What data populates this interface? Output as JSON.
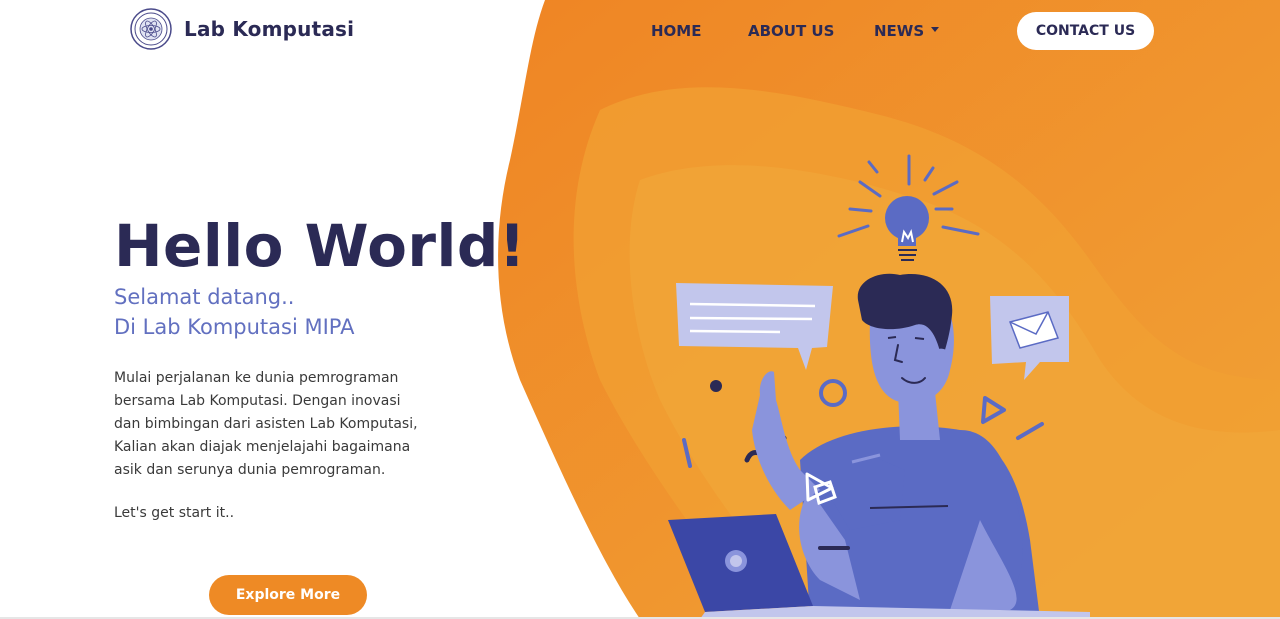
{
  "brand": {
    "name": "Lab Komputasi",
    "logo_icon": "university-seal-icon"
  },
  "nav": {
    "items": [
      {
        "label": "HOME"
      },
      {
        "label": "ABOUT US"
      },
      {
        "label": "NEWS",
        "has_dropdown": true
      }
    ],
    "contact_label": "CONTACT US"
  },
  "hero": {
    "title": "Hello World!",
    "subtitle_line1": "Selamat datang..",
    "subtitle_line2": "Di Lab Komputasi MIPA",
    "description": "Mulai perjalanan ke dunia pemrograman bersama Lab Komputasi. Dengan inovasi dan bimbingan dari asisten Lab Komputasi, Kalian akan diajak menjelajahi bagaimana asik dan serunya dunia pemrograman.",
    "cta_text": "Let's get start it..",
    "button_label": "Explore More"
  },
  "colors": {
    "navy": "#2b2a55",
    "subtitle": "#6270c0",
    "orange": "#ee8a25",
    "orange_light": "#f3a33a",
    "illustration_purple": "#5b6bc4",
    "illustration_lavender": "#b9bde8"
  }
}
